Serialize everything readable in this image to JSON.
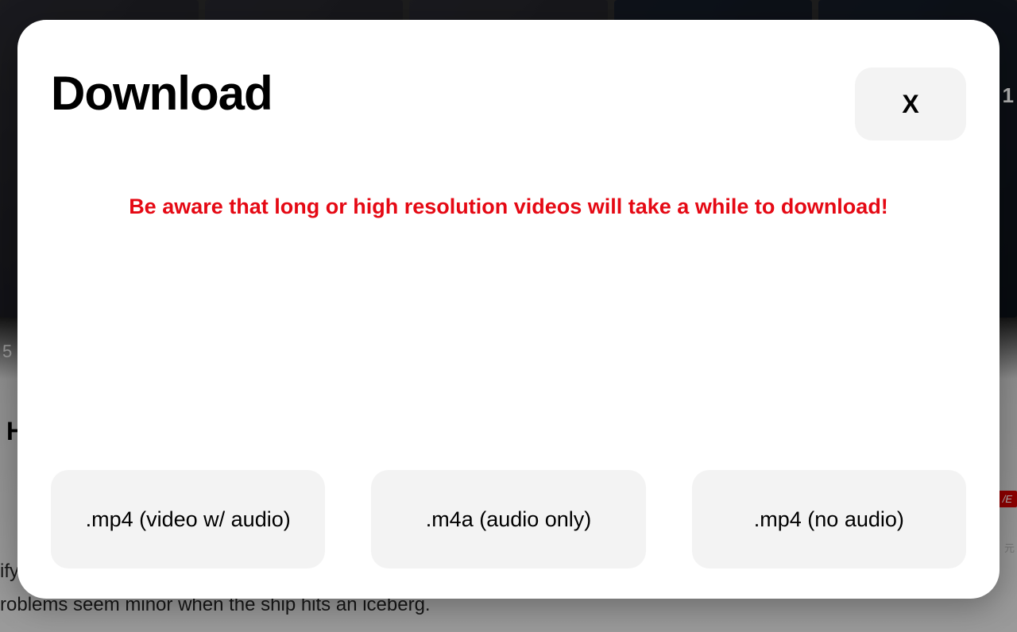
{
  "modal": {
    "title": "Download",
    "close_label": "X",
    "warning": "Be aware that long or high resolution videos will take a while to download!",
    "formats": [
      {
        "label": ".mp4 (video w/ audio)"
      },
      {
        "label": ".m4a (audio only)"
      },
      {
        "label": ".mp4 (no audio)"
      }
    ]
  },
  "backdrop": {
    "text_fragment_1": "ify",
    "text_fragment_2": "roblems seem minor when the ship hits an iceberg.",
    "h_fragment": "H",
    "num_5": "5",
    "num_1": "1",
    "live_badge": "/E",
    "cn_fragment": "元"
  }
}
